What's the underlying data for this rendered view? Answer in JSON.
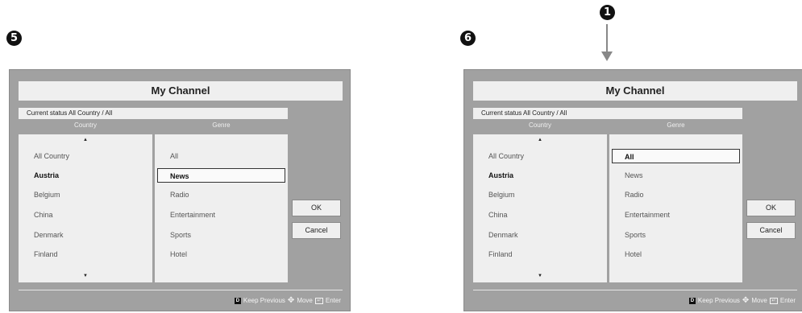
{
  "step_labels": {
    "left": "5",
    "right": "6",
    "top": "1"
  },
  "panels": [
    {
      "title": "My Channel",
      "status": "Current status All Country / All",
      "country_header": "Country",
      "genre_header": "Genre",
      "scroll_up": "▲",
      "scroll_down": "▼",
      "countries": [
        "All Country",
        "Austria",
        "Belgium",
        "China",
        "Denmark",
        "Finland"
      ],
      "genres": [
        "All",
        "News",
        "Radio",
        "Entertainment",
        "Sports",
        "Hotel"
      ],
      "ok_label": "OK",
      "cancel_label": "Cancel",
      "footer": {
        "keep_previous": "Keep Previous",
        "move": "Move",
        "enter": "Enter"
      }
    },
    {
      "title": "My Channel",
      "status": "Current status All Country / All",
      "country_header": "Country",
      "genre_header": "Genre",
      "scroll_up": "▲",
      "scroll_down": "▼",
      "countries": [
        "All Country",
        "Austria",
        "Belgium",
        "China",
        "Denmark",
        "Finland"
      ],
      "genres": [
        "All",
        "News",
        "Radio",
        "Entertainment",
        "Sports",
        "Hotel"
      ],
      "ok_label": "OK",
      "cancel_label": "Cancel",
      "footer": {
        "keep_previous": "Keep Previous",
        "move": "Move",
        "enter": "Enter"
      }
    }
  ],
  "colors": {
    "panel_bg": "#a1a1a1",
    "list_bg": "#efefef",
    "badge": "#111111",
    "arrow": "#888888"
  }
}
